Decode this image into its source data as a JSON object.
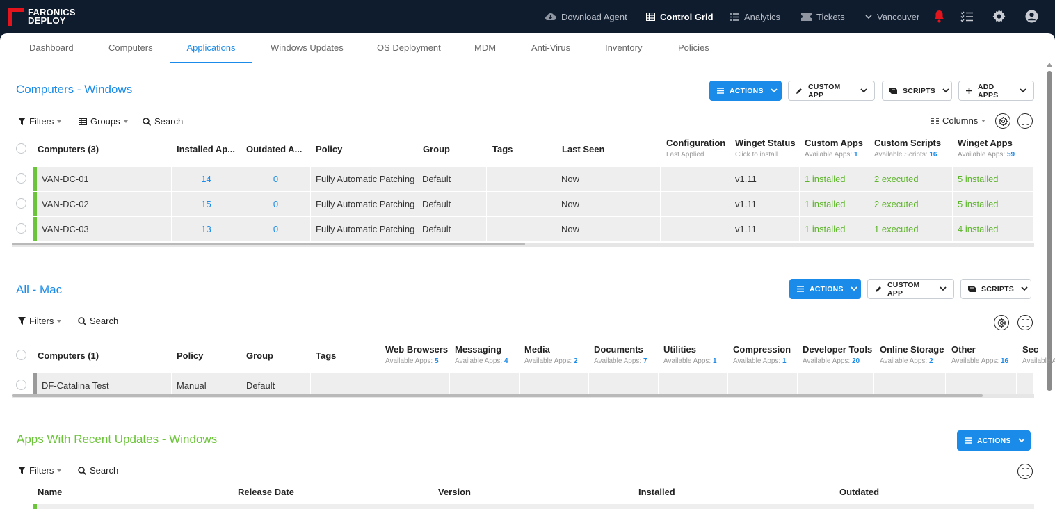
{
  "brand": {
    "line1": "FARONICS",
    "line2": "DEPLOY",
    "color": "#e3141b"
  },
  "topbar": {
    "download_agent": "Download Agent",
    "control_grid": "Control Grid",
    "analytics": "Analytics",
    "tickets": "Tickets",
    "site": "Vancouver"
  },
  "tabs": [
    "Dashboard",
    "Computers",
    "Applications",
    "Windows Updates",
    "OS Deployment",
    "MDM",
    "Anti-Virus",
    "Inventory",
    "Policies"
  ],
  "windows": {
    "title": "Computers - Windows",
    "buttons": {
      "actions": "ACTIONS",
      "custom_app": "CUSTOM APP",
      "scripts": "SCRIPTS",
      "add_apps": "ADD APPS"
    },
    "toolbar": {
      "filters": "Filters",
      "groups": "Groups",
      "search": "Search",
      "columns": "Columns"
    },
    "headers": {
      "computers": "Computers (3)",
      "installed": "Installed Ap...",
      "outdated": "Outdated A...",
      "policy": "Policy",
      "group": "Group",
      "tags": "Tags",
      "last_seen": "Last Seen",
      "configuration": "Configuration",
      "configuration_sub": "Last Applied",
      "winget_status": "Winget Status",
      "winget_status_sub": "Click to install",
      "custom_apps": "Custom Apps",
      "custom_apps_sub": "Available Apps:",
      "custom_apps_count": "1",
      "custom_scripts": "Custom Scripts",
      "custom_scripts_sub": "Available Scripts:",
      "custom_scripts_count": "16",
      "winget_apps": "Winget Apps",
      "winget_apps_sub": "Available Apps:",
      "winget_apps_count": "59"
    },
    "rows": [
      {
        "name": "VAN-DC-01",
        "installed": "14",
        "outdated": "0",
        "policy": "Fully Automatic Patching",
        "group": "Default",
        "tags": "",
        "last_seen": "Now",
        "configuration": "",
        "winget": "v1.11",
        "custom_apps": "1 installed",
        "custom_scripts": "2 executed",
        "winget_apps": "5 installed"
      },
      {
        "name": "VAN-DC-02",
        "installed": "15",
        "outdated": "0",
        "policy": "Fully Automatic Patching",
        "group": "Default",
        "tags": "",
        "last_seen": "Now",
        "configuration": "",
        "winget": "v1.11",
        "custom_apps": "1 installed",
        "custom_scripts": "2 executed",
        "winget_apps": "5 installed"
      },
      {
        "name": "VAN-DC-03",
        "installed": "13",
        "outdated": "0",
        "policy": "Fully Automatic Patching",
        "group": "Default",
        "tags": "",
        "last_seen": "Now",
        "configuration": "",
        "winget": "v1.11",
        "custom_apps": "1 installed",
        "custom_scripts": "1 executed",
        "winget_apps": "4 installed"
      }
    ]
  },
  "mac": {
    "title": "All - Mac",
    "buttons": {
      "actions": "ACTIONS",
      "custom_app": "CUSTOM APP",
      "scripts": "SCRIPTS"
    },
    "toolbar": {
      "filters": "Filters",
      "search": "Search"
    },
    "headers": {
      "computers": "Computers (1)",
      "policy": "Policy",
      "group": "Group",
      "tags": "Tags",
      "sub_label": "Available Apps:",
      "categories": [
        {
          "label": "Web Browsers",
          "count": "5"
        },
        {
          "label": "Messaging",
          "count": "4"
        },
        {
          "label": "Media",
          "count": "2"
        },
        {
          "label": "Documents",
          "count": "7"
        },
        {
          "label": "Utilities",
          "count": "1"
        },
        {
          "label": "Compression",
          "count": "1"
        },
        {
          "label": "Developer Tools",
          "count": "20"
        },
        {
          "label": "Online Storage",
          "count": "2"
        },
        {
          "label": "Other",
          "count": "16"
        },
        {
          "label": "Sec",
          "count": ""
        }
      ]
    },
    "rows": [
      {
        "name": "DF-Catalina Test",
        "policy": "Manual",
        "group": "Default",
        "tags": ""
      }
    ]
  },
  "recent": {
    "title": "Apps With Recent Updates - Windows",
    "buttons": {
      "actions": "ACTIONS"
    },
    "toolbar": {
      "filters": "Filters",
      "search": "Search"
    },
    "headers": {
      "name": "Name",
      "release_date": "Release Date",
      "version": "Version",
      "installed": "Installed",
      "outdated": "Outdated"
    }
  },
  "colors": {
    "accent": "#1a8be8",
    "success": "#6cc43a",
    "nav_bg": "#0f1c2e",
    "alert": "#e3141b"
  }
}
